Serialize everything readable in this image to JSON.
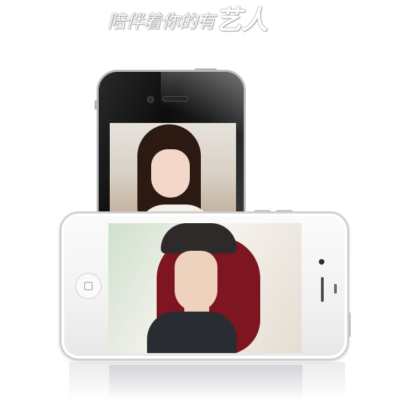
{
  "slogan": {
    "part1": "陪伴着你的有",
    "part2": "艺人"
  },
  "colors": {
    "background": "#ffffff",
    "back_phone": "#111111",
    "front_phone": "#f4f4f4",
    "hair_red": "#7d1621"
  },
  "icons": {
    "home_button": "home-button-icon",
    "camera": "camera-icon",
    "speaker": "speaker-icon"
  }
}
